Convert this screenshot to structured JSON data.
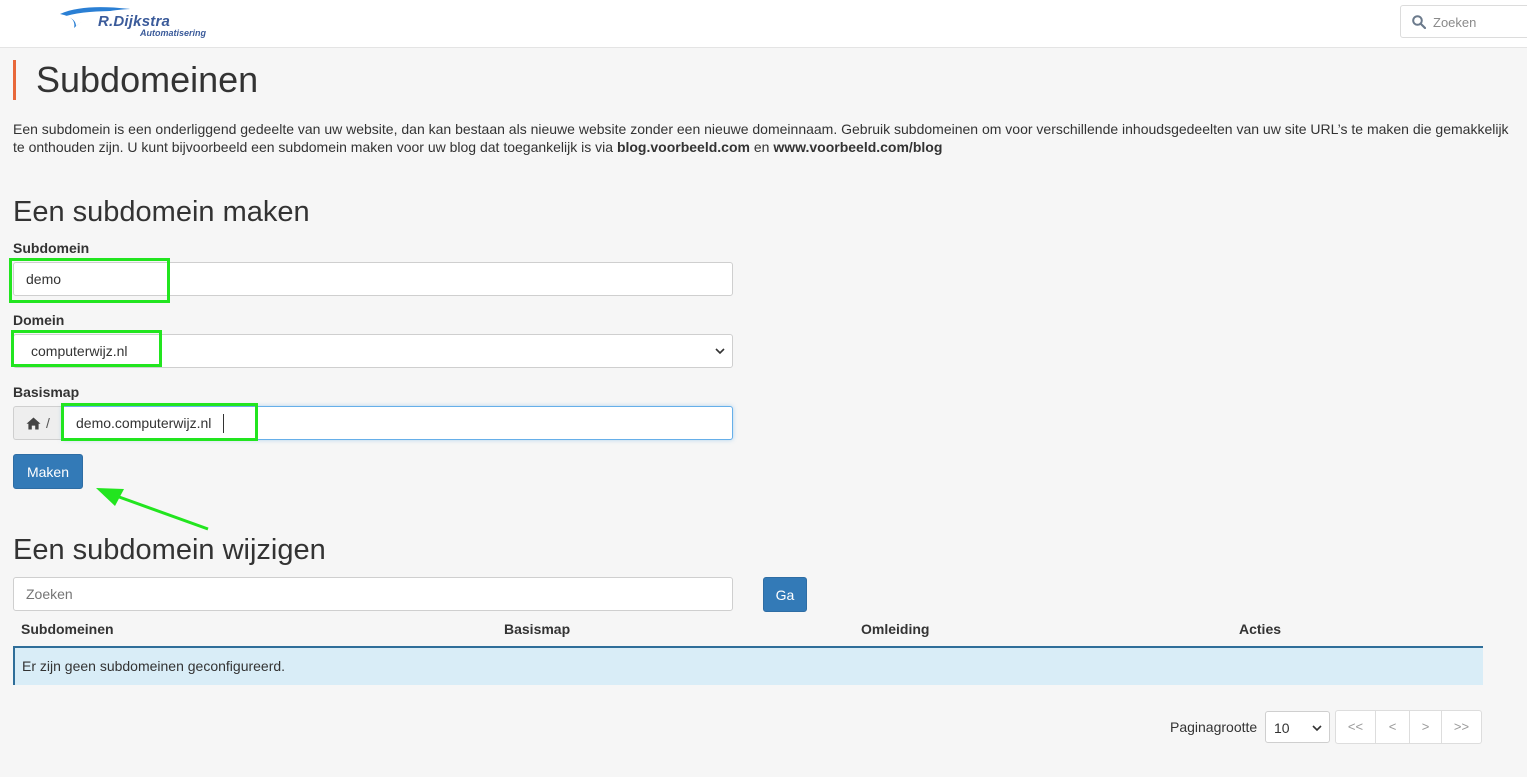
{
  "brand": {
    "name": "R.Dijkstra",
    "subtitle": "Automatisering",
    "color": "#3b5b9a"
  },
  "header": {
    "search_placeholder": "Zoeken"
  },
  "page": {
    "title": "Subdomeinen",
    "intro_text": "Een subdomein is een onderliggend gedeelte van uw website, dan kan bestaan als nieuwe website zonder een nieuwe domeinnaam. Gebruik subdomeinen om voor verschillende inhoudsgedeelten van uw site URL’s te maken die gemakkelijk te onthouden zijn. U kunt bijvoorbeeld een subdomein maken voor uw blog dat toegankelijk is via ",
    "intro_example1": "blog.voorbeeld.com",
    "intro_and": " en ",
    "intro_example2": "www.voorbeeld.com/blog",
    "accent_color": "#e8683a"
  },
  "create": {
    "heading": "Een subdomein maken",
    "subdomain_label": "Subdomein",
    "subdomain_value": "demo",
    "domain_label": "Domein",
    "domain_value": "computerwijz.nl",
    "docroot_label": "Basismap",
    "docroot_prefix": "/",
    "docroot_value": "demo.computerwijz.nl",
    "submit_label": "Maken",
    "button_color": "#337ab7",
    "highlight_color": "#22e51f"
  },
  "manage": {
    "heading": "Een subdomein wijzigen",
    "search_placeholder": "Zoeken",
    "go_label": "Ga",
    "columns": [
      "Subdomeinen",
      "Basismap",
      "Omleiding",
      "Acties"
    ],
    "empty_message": "Er zijn geen subdomeinen geconfigureerd.",
    "empty_row_color": "#d9edf7"
  },
  "pagination": {
    "page_size_label": "Paginagrootte",
    "page_size_value": "10",
    "first_label": "<<",
    "prev_label": "<",
    "next_label": ">",
    "last_label": ">>"
  }
}
